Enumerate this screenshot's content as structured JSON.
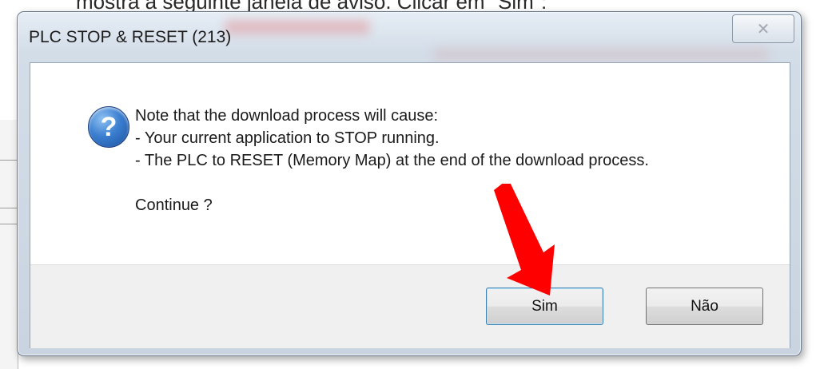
{
  "background": {
    "caption_text": "mostra a seguinte janela de aviso. Clicar em \"Sim\":"
  },
  "dialog": {
    "title": "PLC STOP & RESET (213)",
    "close_glyph": "✕",
    "icon": "question-icon",
    "message_lines": [
      "Note that the download process will cause:",
      "- Your current application to STOP running.",
      "- The PLC to RESET (Memory Map) at the end of the download process."
    ],
    "prompt": "Continue ?",
    "buttons": {
      "yes_label": "Sim",
      "no_label": "Não"
    }
  },
  "annotation": {
    "arrow_color": "#ff0000"
  },
  "colors": {
    "title_bar": "#d3dde8",
    "icon_blue": "#3b7fd0"
  }
}
